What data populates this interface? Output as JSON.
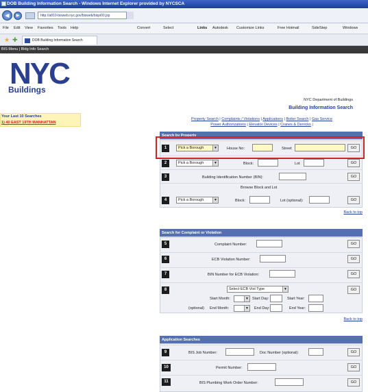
{
  "browser": {
    "title": "DOB Building Information Search - Windows Internet Explorer provided by NYCSCA",
    "address": "http://a810-bisweb.nyc.gov/bisweb/bispi00.jsp",
    "menu": [
      "File",
      "Edit",
      "View",
      "Favorites",
      "Tools",
      "Help"
    ],
    "toolbar": [
      "Convert",
      "Select",
      "Links",
      "Autodesk",
      "Customize Links",
      "Free Hotmail",
      "SideStep",
      "Windows"
    ],
    "tab_title": "DOB Building Information Search"
  },
  "site_nav": "BIS Menu | Bldg Info Search",
  "logo": {
    "text": "NYC",
    "sub": "Buildings"
  },
  "last_searches": {
    "heading": "Your Last 10 Searches",
    "item": "1) 40 EAST 19TH MANHATTAN"
  },
  "header": {
    "dept": "NYC Department of Buildings",
    "title": "Building Information Search"
  },
  "links": {
    "line1": [
      "Property Search",
      "Complaints / Violations",
      "Applications",
      "Boiler Search",
      "Gas Service"
    ],
    "line2": [
      "Power Authorizations",
      "Elevator Devices",
      "Cranes & Derricks"
    ]
  },
  "property": {
    "heading": "Search by Property",
    "r1": {
      "num": "1",
      "borough": "Pick a Borough",
      "house": "House No:",
      "street": "Street",
      "go": "GO"
    },
    "r2": {
      "num": "2",
      "borough": "Pick a Borough",
      "block": "Block:",
      "lot": "Lot",
      "go": "GO"
    },
    "r3": {
      "num": "3",
      "label": "Building Identification Number (BIN):",
      "go": "GO"
    },
    "r4": {
      "num": "4",
      "title": "Browse Block and Lot",
      "borough": "Pick a Borough",
      "block": "Block:",
      "lot": "Lot (optional):",
      "go": "GO"
    },
    "back": "Back to top"
  },
  "complaint": {
    "heading": "Search for Complaint or Violation",
    "r5": {
      "num": "5",
      "label": "Complaint Number:",
      "go": "GO"
    },
    "r6": {
      "num": "6",
      "label": "ECB Violation Number:",
      "go": "GO"
    },
    "r7": {
      "num": "7",
      "label": "BIN Number for ECB Violation:",
      "go": "GO"
    },
    "r8": {
      "num": "8",
      "type": "Select ECB Viol Type",
      "start_month": "Start Month:",
      "start_day": "Start Day:",
      "start_year": "Start Year:",
      "optional": "(optional)",
      "end_month": "End Month:",
      "end_day": "End Day:",
      "end_year": "End Year:",
      "go": "GO"
    },
    "back": "Back to top"
  },
  "applications": {
    "heading": "Application Searches",
    "r9": {
      "num": "9",
      "job": "BIS Job Number:",
      "doc": "Doc Number (optional):",
      "go": "GO"
    },
    "r10": {
      "num": "10",
      "label": "Permit Number:",
      "go": "GO"
    },
    "r11": {
      "num": "11",
      "label": "BIS Plumbing Work Order Number:",
      "go": "GO"
    }
  },
  "colors": {
    "highlight": "#d42020",
    "section_header": "#5470b0",
    "link": "#1f3f99"
  }
}
